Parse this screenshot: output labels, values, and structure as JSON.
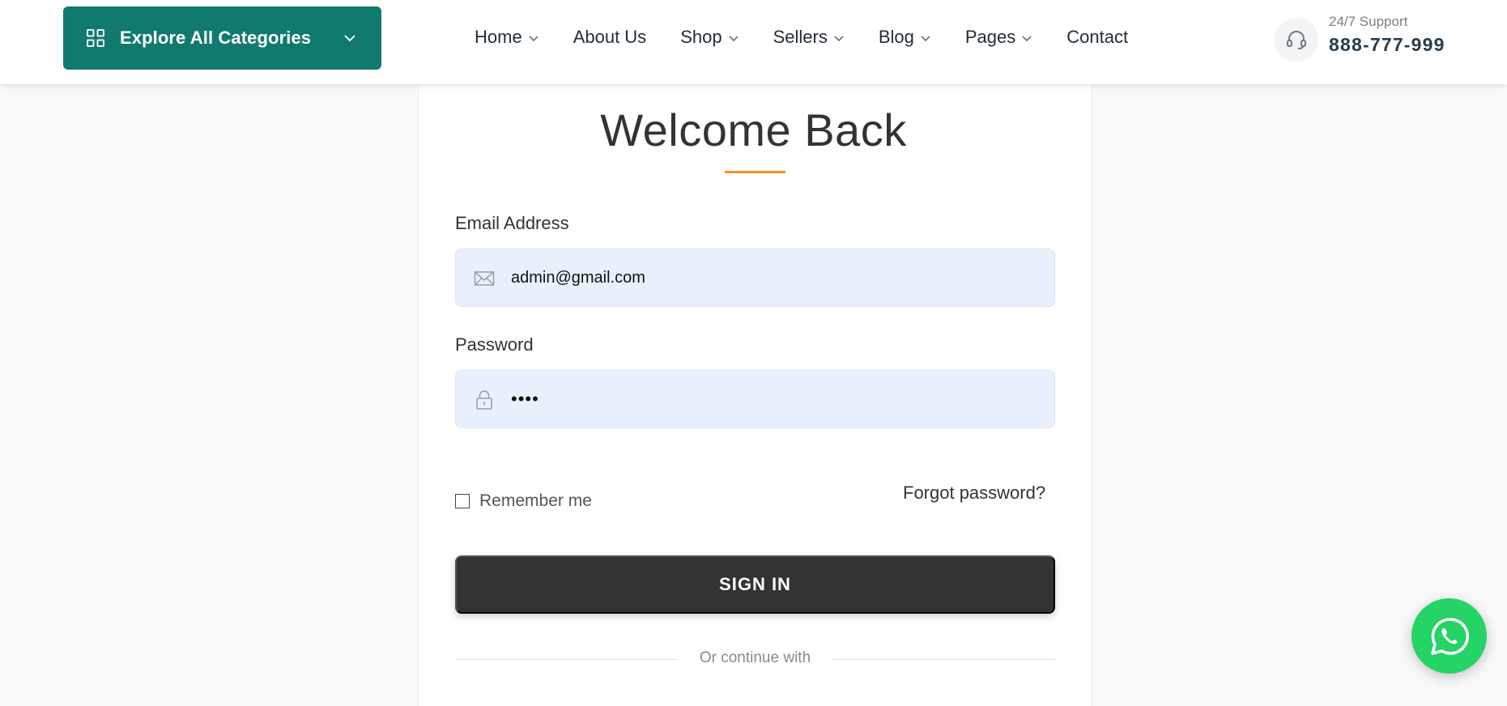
{
  "header": {
    "categories_button": {
      "label": "Explore All Categories",
      "icon": "grid-icon",
      "caret": "chevron-down-icon"
    },
    "nav": [
      {
        "label": "Home",
        "has_dropdown": true
      },
      {
        "label": "About Us",
        "has_dropdown": false
      },
      {
        "label": "Shop",
        "has_dropdown": true
      },
      {
        "label": "Sellers",
        "has_dropdown": true
      },
      {
        "label": "Blog",
        "has_dropdown": true
      },
      {
        "label": "Pages",
        "has_dropdown": true
      },
      {
        "label": "Contact",
        "has_dropdown": false
      }
    ],
    "support": {
      "icon": "headset-icon",
      "label": "24/7 Support",
      "phone": "888-777-999"
    }
  },
  "login": {
    "title": "Welcome Back",
    "email": {
      "label": "Email Address",
      "value": "admin@gmail.com",
      "icon": "envelope-icon"
    },
    "password": {
      "label": "Password",
      "value": "••••",
      "icon": "lock-icon"
    },
    "remember_label": "Remember me",
    "remember_checked": false,
    "forgot_label": "Forgot password?",
    "submit_label": "SIGN IN",
    "divider_text": "Or continue with"
  },
  "floating": {
    "whatsapp_icon": "whatsapp-icon"
  },
  "colors": {
    "brand_green": "#117a6e",
    "accent_orange": "#f7931e",
    "input_bg": "#e8f0fe",
    "button_dark": "#333333",
    "whatsapp": "#25d366"
  }
}
